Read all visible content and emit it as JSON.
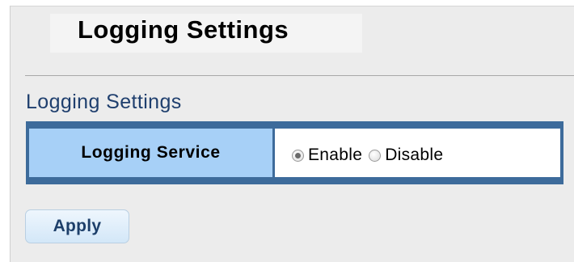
{
  "header": {
    "title": "Logging Settings"
  },
  "section": {
    "title": "Logging Settings"
  },
  "settings": {
    "logging_service": {
      "label": "Logging Service",
      "options": [
        {
          "label": "Enable",
          "selected": true
        },
        {
          "label": "Disable",
          "selected": false
        }
      ]
    }
  },
  "actions": {
    "apply_label": "Apply"
  },
  "colors": {
    "table_border": "#3d6b9b",
    "label_cell": "#a7d0f7",
    "section_title": "#1f3f6e",
    "button_text": "#1d3f6a"
  }
}
